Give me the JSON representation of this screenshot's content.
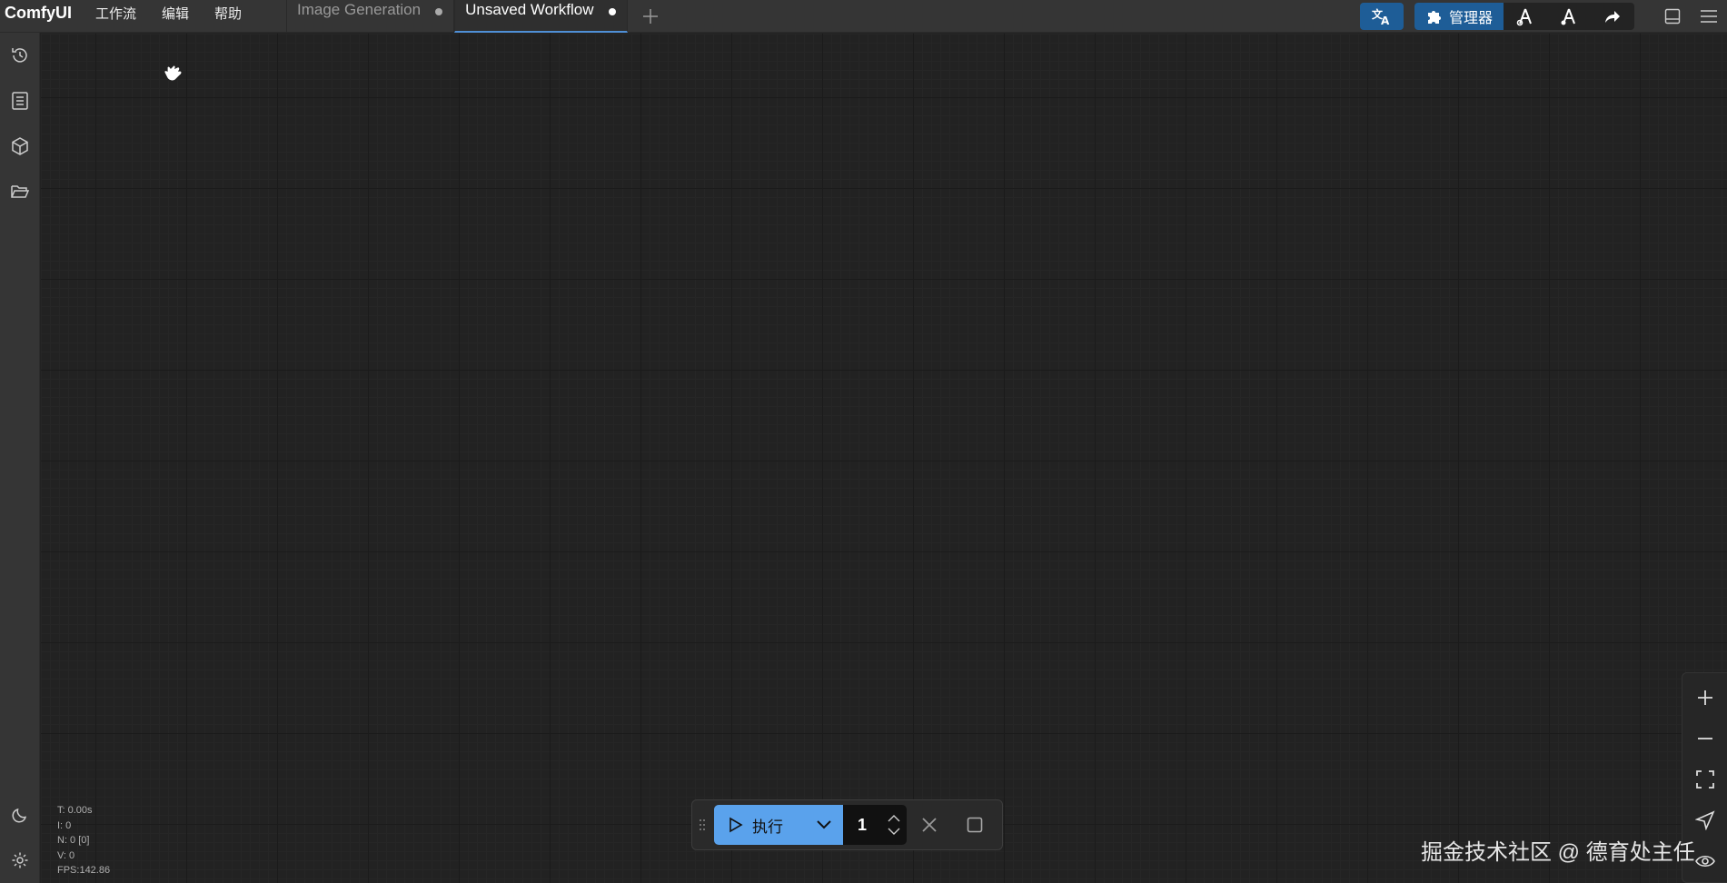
{
  "app": {
    "brand": "ComfyUI"
  },
  "menu": [
    "工作流",
    "编辑",
    "帮助"
  ],
  "tabs": [
    {
      "label": "Image Generation",
      "active": false
    },
    {
      "label": "Unsaved Workflow",
      "active": true
    }
  ],
  "toolbar": {
    "translate_icon": "translate-icon",
    "manager_label": "管理器",
    "manager_icon": "puzzle-icon"
  },
  "stats": {
    "t": "T: 0.00s",
    "i": "I: 0",
    "n": "N: 0 [0]",
    "v": "V: 0",
    "fps": "FPS:142.86"
  },
  "runbar": {
    "run_label": "执行",
    "batch_count": "1"
  },
  "watermark": "掘金技术社区 @ 德育处主任",
  "colors": {
    "accent": "#5aa2ec",
    "manager_bg": "#1e5d97",
    "canvas_bg": "#222222",
    "bar_bg": "#353535"
  }
}
